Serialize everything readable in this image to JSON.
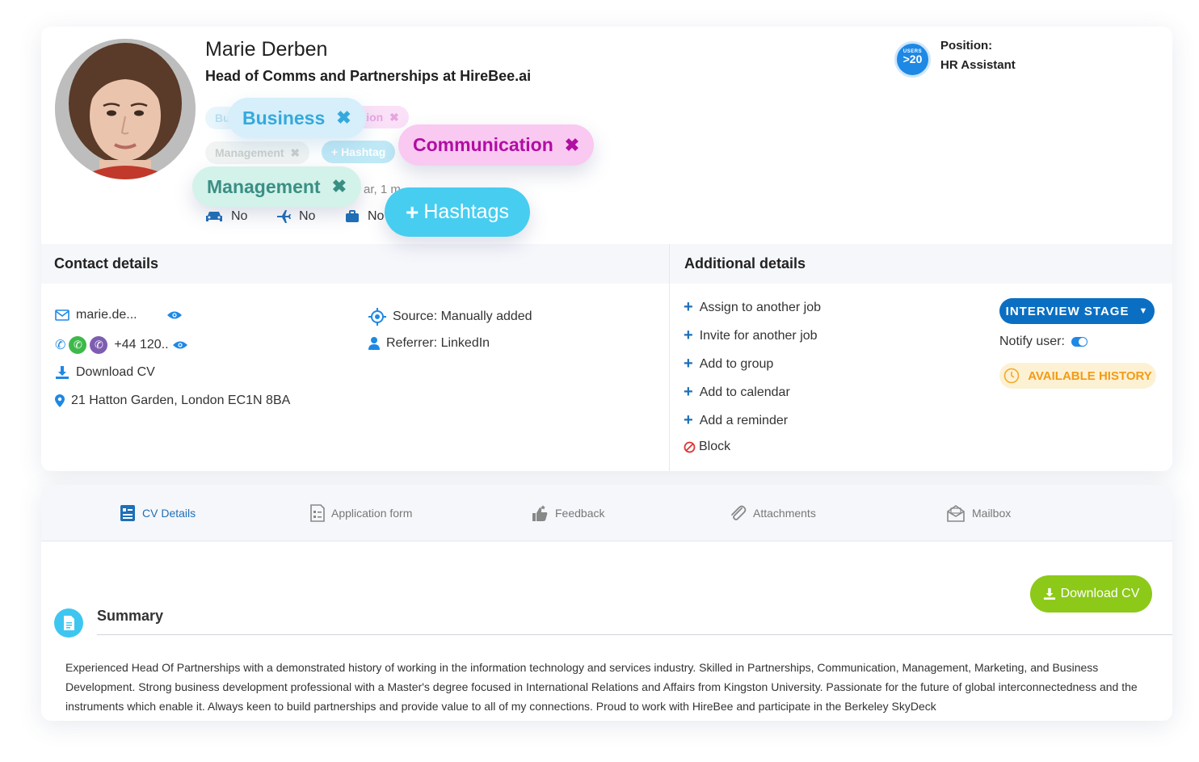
{
  "profile": {
    "name": "Marie Derben",
    "headline": "Head of Comms and Partnerships at HireBee.ai"
  },
  "tags_faded": {
    "business_partial": "Bu",
    "communication_partial": "cation",
    "management": "Management",
    "hashtags_partial": "+ Hashtag",
    "duration_partial": "ar, 1 m"
  },
  "tags": {
    "business": "Business",
    "communication": "Communication",
    "management": "Management",
    "hashtags": "Hashtags"
  },
  "meta": {
    "car": "No",
    "travel": "No",
    "work": "No"
  },
  "position": {
    "badge_top": "USERS",
    "badge_value": ">20",
    "label": "Position:",
    "value": "HR Assistant"
  },
  "contact": {
    "heading": "Contact details",
    "email": "marie.de...",
    "phone": "+44 120..",
    "download": "Download CV",
    "address": "21 Hatton Garden, London EC1N 8BA",
    "source": "Source: Manually added",
    "referrer": "Referrer: LinkedIn"
  },
  "additional": {
    "heading": "Additional details",
    "actions": [
      "Assign to another job",
      "Invite for another job",
      "Add to group",
      "Add to calendar",
      "Add a reminder"
    ],
    "block": "Block",
    "stage": "INTERVIEW STAGE",
    "notify": "Notify user:",
    "history": "AVAILABLE HISTORY"
  },
  "tabs": [
    "CV Details",
    "Application form",
    "Feedback",
    "Attachments",
    "Mailbox"
  ],
  "cv": {
    "download": "Download CV",
    "summary_title": "Summary",
    "summary_text": "Experienced Head Of Partnerships with a demonstrated history of working in the information technology and services industry. Skilled in Partnerships, Communication, Management, Marketing, and Business Development. Strong business development professional with a Master's degree focused in International Relations and Affairs from Kingston University. Passionate for the future of global interconnectedness and the instruments which enable it. Always keen to build partnerships and provide value to all of my connections. Proud to work with HireBee and participate in the Berkeley SkyDeck"
  },
  "colors": {
    "primary": "#0a6fc2",
    "business_tag": "#d6effa",
    "communication_tag": "#f9c9f1",
    "management_tag": "#d3f2ea",
    "hashtag_tag": "#47cdf0",
    "download_green": "#8cc919",
    "history_orange": "#f29b16"
  }
}
